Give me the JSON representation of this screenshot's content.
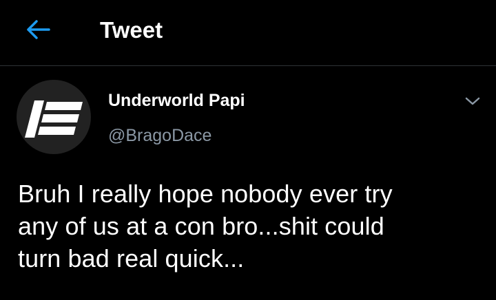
{
  "header": {
    "back_icon": "arrow-left-icon",
    "title": "Tweet"
  },
  "tweet": {
    "author": {
      "display_name": "Underworld Papi",
      "handle": "@BragoDace",
      "avatar_icon": "logo-icon"
    },
    "more_icon": "chevron-down-icon",
    "text_lines": [
      "Bruh I really hope nobody ever try",
      "any of us at a con bro...shit could",
      "turn bad real quick..."
    ]
  },
  "colors": {
    "background": "#000000",
    "accent": "#1d9bf0",
    "secondary_text": "#8b98a5",
    "divider": "#2f3336"
  }
}
